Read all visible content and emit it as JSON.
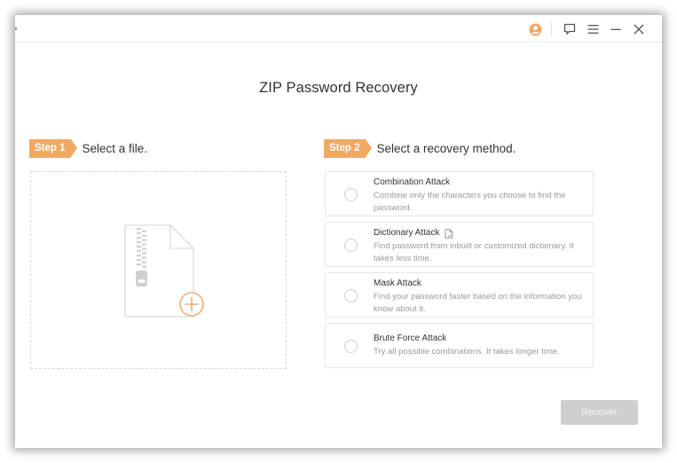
{
  "window": {
    "title_bar_icons": [
      {
        "name": "user-account-icon",
        "color": "#f0a962"
      },
      {
        "name": "feedback-icon"
      },
      {
        "name": "menu-icon"
      },
      {
        "name": "minimize-icon"
      },
      {
        "name": "close-icon"
      }
    ]
  },
  "header": {
    "title": "ZIP Password Recovery"
  },
  "step1": {
    "badge": "Step 1",
    "label": "Select a file.",
    "drop_zone_icon": "zip-file-add-icon"
  },
  "step2": {
    "badge": "Step 2",
    "label": "Select a recovery method."
  },
  "methods": [
    {
      "title": "Combination Attack",
      "description": "Combine only the characters you choose to find the password.",
      "selected": false
    },
    {
      "title": "Dictionary Attack",
      "description": "Find password from inbuilt or customized dictionary. It takes less time.",
      "selected": false,
      "extra_icon": "dictionary-file-icon"
    },
    {
      "title": "Mask Attack",
      "description": "Find your password faster based on the information you know about it.",
      "selected": false
    },
    {
      "title": "Brute Force Attack",
      "description": "Try all possible combinations. It takes longer time.",
      "selected": false
    }
  ],
  "footer": {
    "recover_label": "Recover",
    "recover_enabled": false
  },
  "colors": {
    "accent": "#f0a962",
    "disabled_button": "#cfcfcf",
    "text_primary": "#333333",
    "text_secondary": "#9a9a9a"
  }
}
